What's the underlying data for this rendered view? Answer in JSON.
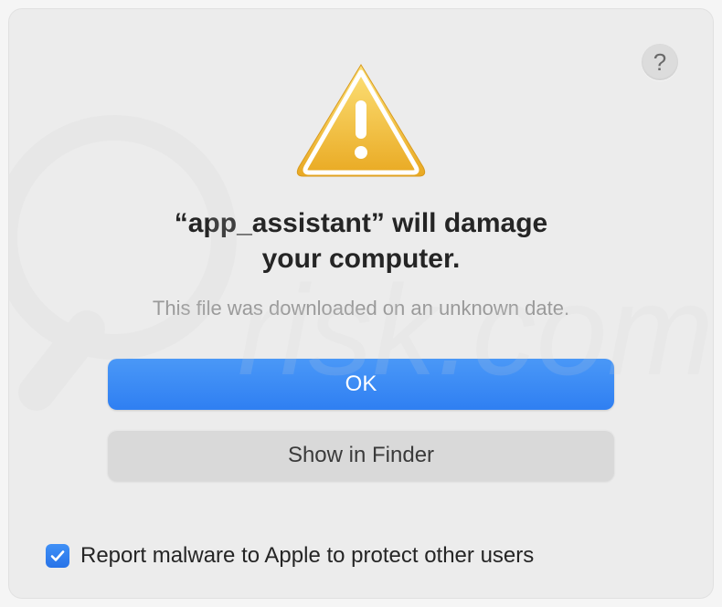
{
  "dialog": {
    "help_symbol": "?",
    "title_line1": "“app_assistant” will damage",
    "title_line2": "your computer.",
    "subtitle": "This file was downloaded on an unknown date.",
    "primary_button": "OK",
    "secondary_button": "Show in Finder",
    "checkbox_label": "Report malware to Apple to protect other users",
    "checkbox_checked": true
  },
  "colors": {
    "primary_blue": "#2f7ff2",
    "secondary_gray": "#d9d9d9",
    "dialog_bg": "#ececec"
  }
}
